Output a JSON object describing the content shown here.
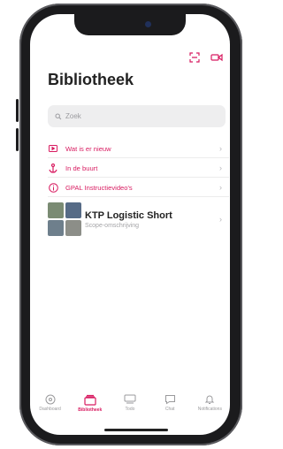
{
  "colors": {
    "accent": "#d81b60",
    "text": "#222222",
    "muted": "#9b9b9f"
  },
  "header": {
    "title": "Bibliotheek",
    "icons": [
      "scan-icon",
      "video-icon"
    ]
  },
  "search": {
    "placeholder": "Zoek"
  },
  "menu": {
    "items": [
      {
        "label": "Wat is er nieuw",
        "icon": "play-icon"
      },
      {
        "label": "In de buurt",
        "icon": "anchor-icon"
      },
      {
        "label": "GPAL Instructievideo's",
        "icon": "info-icon"
      }
    ]
  },
  "library": {
    "items": [
      {
        "title": "KTP Logistic Short",
        "subtitle": "Scope-omschrijving"
      }
    ]
  },
  "tabbar": {
    "tabs": [
      {
        "label": "Dashboard",
        "icon": "dashboard-icon",
        "active": false
      },
      {
        "label": "Bibliotheek",
        "icon": "library-icon",
        "active": true
      },
      {
        "label": "Todo",
        "icon": "todo-icon",
        "active": false
      },
      {
        "label": "Chat",
        "icon": "chat-icon",
        "active": false
      },
      {
        "label": "Notifications",
        "icon": "bell-icon",
        "active": false
      }
    ]
  }
}
